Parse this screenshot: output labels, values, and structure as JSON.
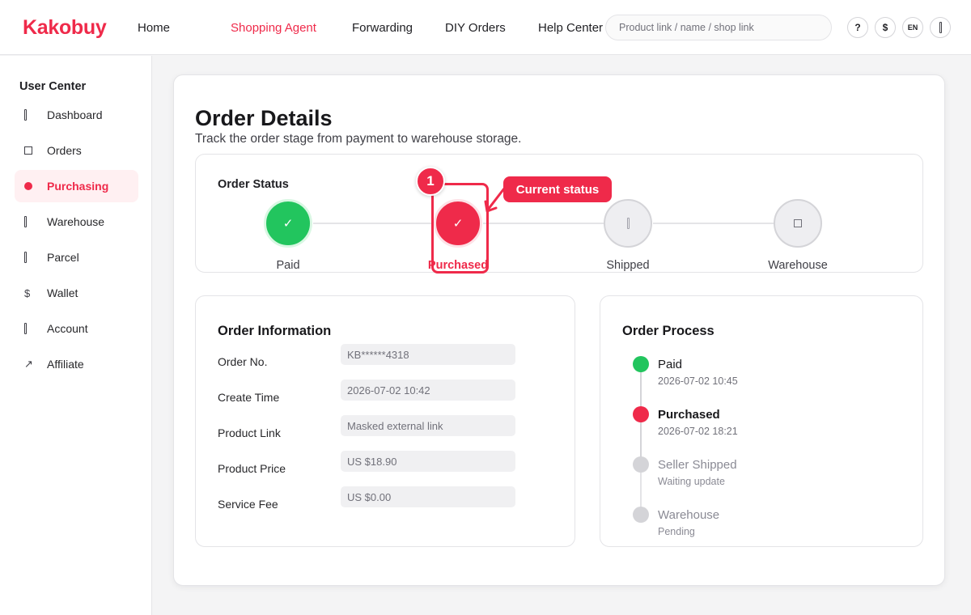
{
  "brand": "Kakobuy",
  "nav": [
    {
      "label": "Home"
    },
    {
      "label": "Shopping Agent"
    },
    {
      "label": "Forwarding"
    },
    {
      "label": "DIY Orders"
    },
    {
      "label": "Help Center"
    }
  ],
  "search": {
    "placeholder": "Product link / name / shop link"
  },
  "header_buttons": [
    {
      "label": "?",
      "icon": "help-icon"
    },
    {
      "label": "$",
      "icon": "currency-icon"
    },
    {
      "label": "EN",
      "icon": "language-icon"
    },
    {
      "label": "",
      "icon": "account-icon"
    }
  ],
  "sidebar": {
    "title": "User Center",
    "items": [
      {
        "label": "Dashboard",
        "icon": "dashboard-icon"
      },
      {
        "label": "Orders",
        "icon": "orders-icon"
      },
      {
        "label": "Purchasing",
        "icon": "purchasing-icon"
      },
      {
        "label": "Warehouse",
        "icon": "warehouse-icon"
      },
      {
        "label": "Parcel",
        "icon": "parcel-icon"
      },
      {
        "label": "Wallet",
        "icon": "wallet-icon",
        "glyph": "$"
      },
      {
        "label": "Account",
        "icon": "account-icon"
      },
      {
        "label": "Affiliate",
        "icon": "affiliate-icon",
        "glyph": "↗"
      }
    ]
  },
  "page": {
    "title": "Order Details",
    "subtitle": "Track the order stage from payment to warehouse storage."
  },
  "order_status": {
    "title": "Order Status",
    "steps": [
      {
        "label": "Paid",
        "state": "done",
        "glyph": "✓"
      },
      {
        "label": "Purchased",
        "state": "current",
        "glyph": "✓"
      },
      {
        "label": "Shipped",
        "state": "pending"
      },
      {
        "label": "Warehouse",
        "state": "pending"
      }
    ]
  },
  "order_info": {
    "title": "Order Information",
    "fields": [
      {
        "label": "Order No.",
        "value": "KB******4318"
      },
      {
        "label": "Create Time",
        "value": "2026-07-02 10:42"
      },
      {
        "label": "Product Link",
        "value": "Masked external link"
      },
      {
        "label": "Product Price",
        "value": "US $18.90"
      },
      {
        "label": "Service Fee",
        "value": "US $0.00"
      }
    ]
  },
  "order_process": {
    "title": "Order Process",
    "events": [
      {
        "title": "Paid",
        "date": "2026-07-02 10:45",
        "state": "done"
      },
      {
        "title": "Purchased",
        "date": "2026-07-02 18:21",
        "state": "current"
      },
      {
        "title": "Seller Shipped",
        "date": "Waiting update",
        "state": "pending"
      },
      {
        "title": "Warehouse",
        "date": "Pending",
        "state": "pending"
      }
    ]
  },
  "annotation": {
    "number": "1",
    "label": "Current status"
  },
  "colors": {
    "accent": "#ef2a4a",
    "success": "#22c55e",
    "muted": "#d4d4d8"
  }
}
